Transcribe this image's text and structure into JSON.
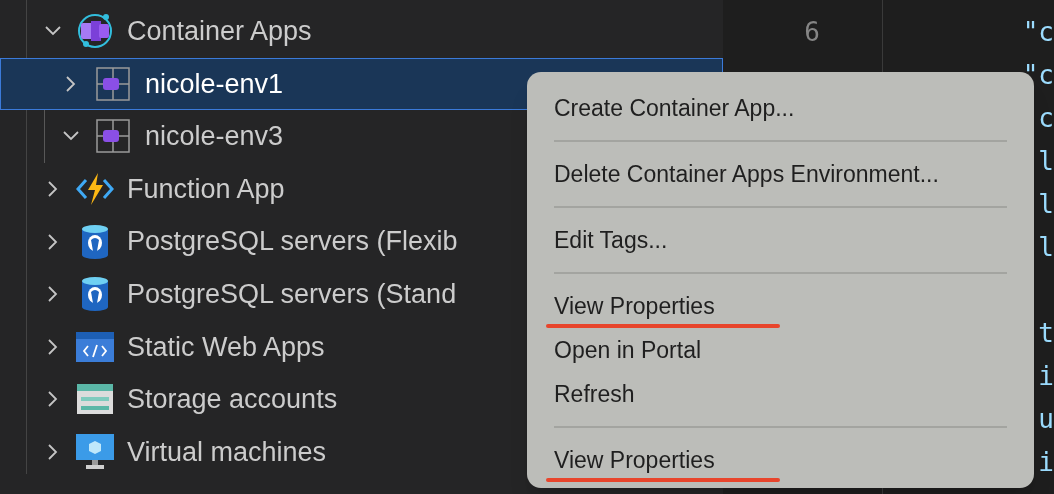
{
  "tree": [
    {
      "label": "Container Apps",
      "kind": "container-apps",
      "expanded": true,
      "selected": false,
      "children": [
        {
          "label": "nicole-env1",
          "kind": "environment",
          "expanded": false,
          "selected": true
        },
        {
          "label": "nicole-env3",
          "kind": "environment",
          "expanded": true,
          "selected": false
        }
      ]
    },
    {
      "label": "Function App",
      "kind": "function",
      "expanded": false,
      "selected": false
    },
    {
      "label": "PostgreSQL servers (Flexib",
      "kind": "postgres",
      "expanded": false,
      "selected": false
    },
    {
      "label": "PostgreSQL servers (Stand",
      "kind": "postgres",
      "expanded": false,
      "selected": false
    },
    {
      "label": "Static Web Apps",
      "kind": "static-web",
      "expanded": false,
      "selected": false
    },
    {
      "label": "Storage accounts",
      "kind": "storage",
      "expanded": false,
      "selected": false
    },
    {
      "label": "Virtual machines",
      "kind": "vm",
      "expanded": false,
      "selected": false
    }
  ],
  "editor": {
    "line_numbers": [
      "6"
    ],
    "code_blocks": [
      [
        "\"c",
        "\"c",
        "c",
        "l",
        "l",
        "l"
      ],
      [
        "t",
        "i",
        "u",
        "i"
      ]
    ]
  },
  "context_menu": {
    "groups": [
      [
        {
          "label": "Create Container App...",
          "underlined": false
        }
      ],
      [
        {
          "label": "Delete Container Apps Environment...",
          "underlined": false
        }
      ],
      [
        {
          "label": "Edit Tags...",
          "underlined": false
        }
      ],
      [
        {
          "label": "View Properties",
          "underlined": true
        },
        {
          "label": "Open in Portal",
          "underlined": false
        },
        {
          "label": "Refresh",
          "underlined": false
        }
      ],
      [
        {
          "label": "View Properties",
          "underlined": true
        }
      ]
    ]
  }
}
